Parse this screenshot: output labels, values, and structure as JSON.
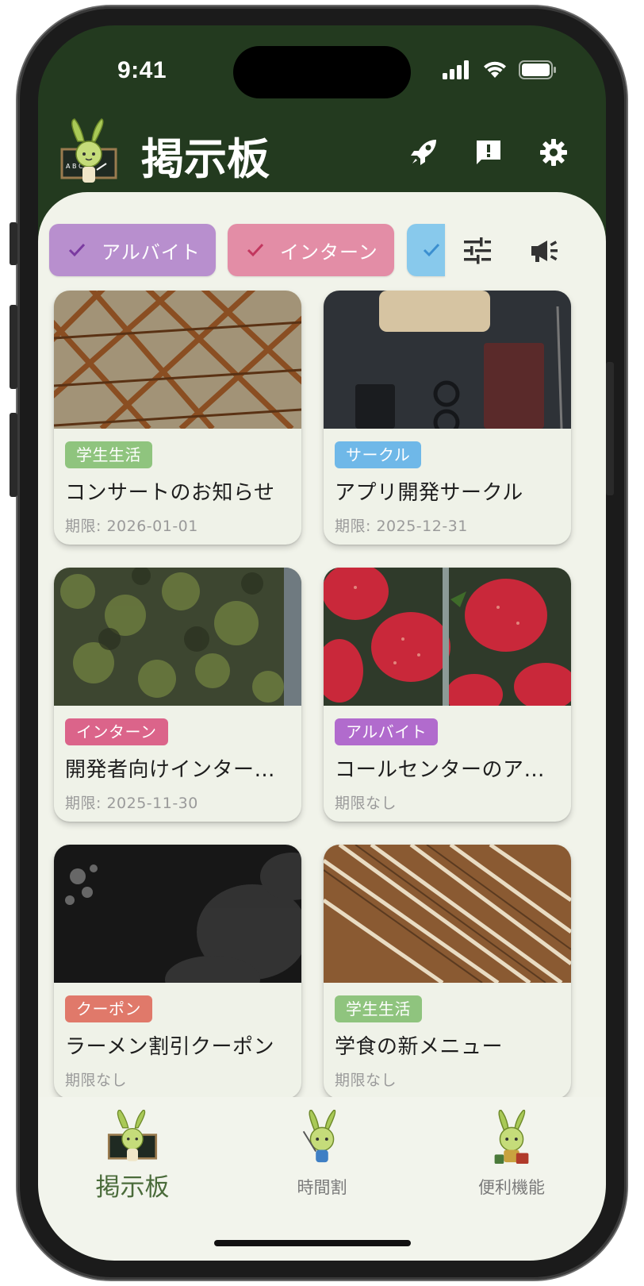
{
  "status_bar": {
    "time": "9:41"
  },
  "header": {
    "title": "掲示板",
    "icons": [
      "rocket-icon",
      "feedback-icon",
      "settings-icon"
    ]
  },
  "filters": {
    "chips": [
      {
        "label": "アルバイト",
        "color": "#b88fce",
        "check_color": "#7a3aa0"
      },
      {
        "label": "インターン",
        "color": "#e38da6",
        "check_color": "#c2365e"
      },
      {
        "label": "",
        "color": "#88c9ec",
        "check_color": "#3b8fd0"
      }
    ],
    "tools": [
      "tune-icon",
      "campaign-icon"
    ]
  },
  "cards": [
    {
      "tag": "学生生活",
      "tag_color": "#8fc47e",
      "title": "コンサートのお知らせ",
      "deadline": "期限: 2026-01-01",
      "image": "steel-lattice"
    },
    {
      "tag": "サークル",
      "tag_color": "#6fb8e8",
      "title": "アプリ開発サークル",
      "deadline": "期限: 2025-12-31",
      "image": "desk-glasses"
    },
    {
      "tag": "インターン",
      "tag_color": "#db648a",
      "title": "開発者向けインター…",
      "deadline": "期限: 2025-11-30",
      "image": "mossy-wall"
    },
    {
      "tag": "アルバイト",
      "tag_color": "#b16bcd",
      "title": "コールセンターのア…",
      "deadline": "期限なし",
      "image": "strawberries"
    },
    {
      "tag": "クーポン",
      "tag_color": "#e0796a",
      "title": "ラーメン割引クーポン",
      "deadline": "期限なし",
      "image": "dark-rocks"
    },
    {
      "tag": "学生生活",
      "tag_color": "#8fc47e",
      "title": "学食の新メニュー",
      "deadline": "期限なし",
      "image": "chopsticks"
    }
  ],
  "bottom_nav": {
    "items": [
      {
        "label": "掲示板",
        "active": true
      },
      {
        "label": "時間割",
        "active": false
      },
      {
        "label": "便利機能",
        "active": false
      }
    ],
    "active_color": "#4a6b3a",
    "inactive_color": "#7a7a7a"
  },
  "colors": {
    "header_bg": "#233a1f",
    "content_bg": "#f1f3ea"
  }
}
